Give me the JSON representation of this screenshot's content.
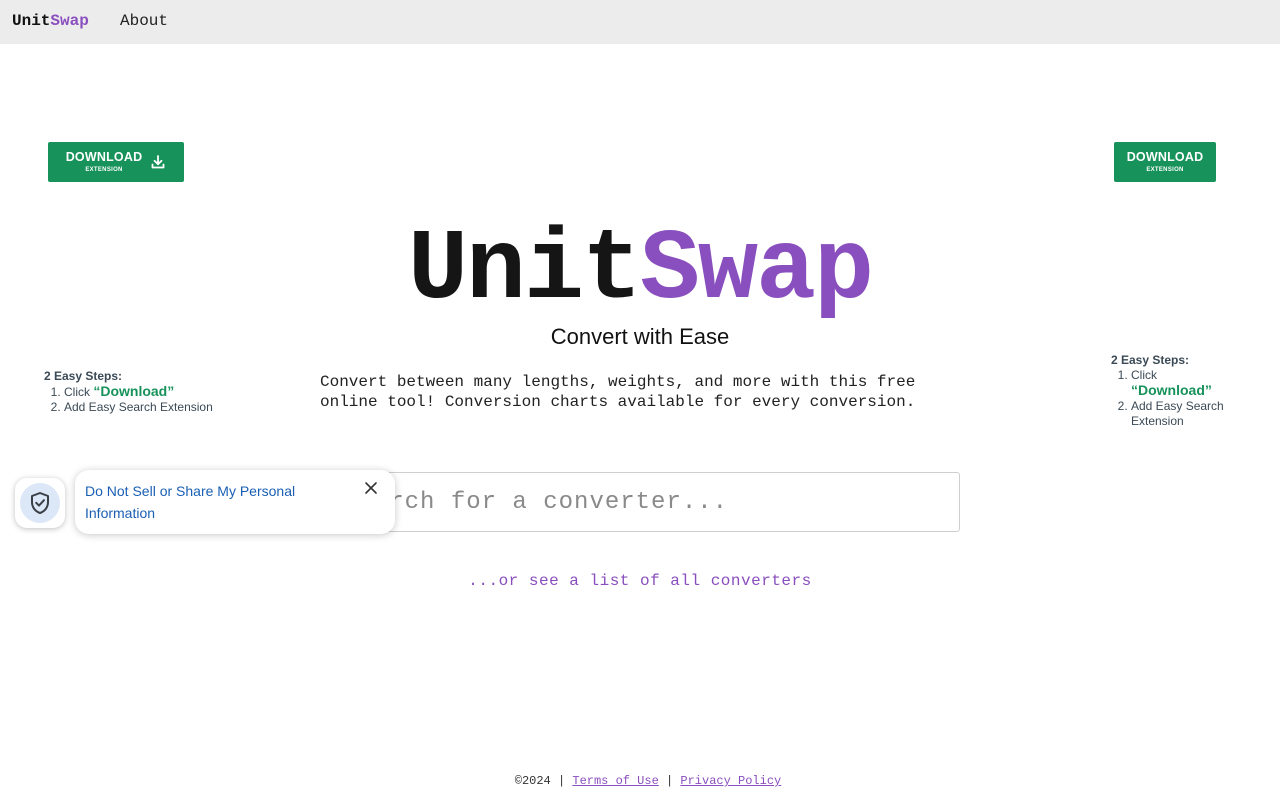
{
  "nav": {
    "logo_unit": "Unit",
    "logo_swap": "Swap",
    "about": "About"
  },
  "download_left": {
    "label": "DOWNLOAD",
    "sub": "EXTENSION"
  },
  "download_right": {
    "label": "DOWNLOAD",
    "sub": "EXTENSION"
  },
  "steps_left": {
    "title": "2 Easy Steps:",
    "step1_prefix": "Click ",
    "step1_highlight": "“Download”",
    "step2": "Add Easy Search Extension"
  },
  "steps_right": {
    "title": "2 Easy Steps:",
    "step1_prefix": "Click ",
    "step1_highlight": "“Download”",
    "step2": "Add Easy Search Extension"
  },
  "hero": {
    "logo_unit": "Unit",
    "logo_swap": "Swap",
    "tagline": "Convert with Ease",
    "description": "Convert between many lengths, weights, and more with this free online tool! Conversion charts available for every conversion."
  },
  "search": {
    "placeholder": "Search for a converter..."
  },
  "all_converters_link": "...or see a list of all converters",
  "privacy": {
    "text": "Do Not Sell or Share My Personal Information"
  },
  "footer": {
    "copyright": "©2024",
    "separator": "|",
    "terms": "Terms of Use",
    "privacy": "Privacy Policy"
  },
  "colors": {
    "brand_purple": "#8a4fbe",
    "download_green": "#17925a",
    "nav_bg": "#ececec",
    "privacy_blue": "#1a5fb4"
  },
  "icons": {
    "download": "download-icon",
    "shield": "shield-check-icon",
    "close": "close-icon"
  }
}
